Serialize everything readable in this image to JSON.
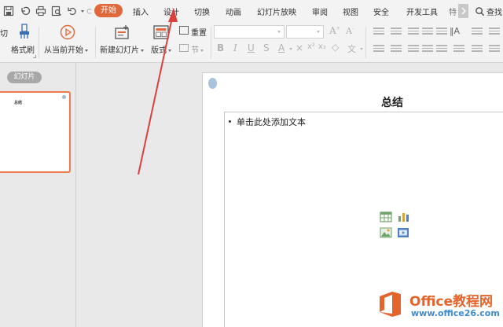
{
  "menu": {
    "tabs": [
      "插入",
      "设计",
      "切换",
      "动画",
      "幻灯片放映",
      "审阅",
      "视图",
      "安全",
      "开发工具"
    ],
    "active_tab": "开始",
    "overflow_tab": "特",
    "search_label": "查找"
  },
  "quick_access": [
    "save-icon",
    "undo-history-icon",
    "print-icon",
    "print-preview-icon",
    "undo-icon",
    "redo-icon"
  ],
  "ribbon": {
    "cut_label": "切",
    "format_painter_label": "格式刷",
    "play_from_current_label": "从当前开始",
    "new_slide_label": "新建幻灯片",
    "layout_label": "版式",
    "reset_label": "重置",
    "section_label": "节"
  },
  "panel": {
    "tab_label": "幻灯片",
    "thumbnail_title": "总结"
  },
  "slide": {
    "title": "总结",
    "content_placeholder": "单击此处添加文本"
  },
  "watermark": {
    "brand_office": "Office",
    "brand_cn": "教程网",
    "url": "www.office26.com"
  },
  "colors": {
    "accent": "#e0693c",
    "arrow": "#d9413d",
    "thumbnail_border": "#ef7a4d"
  }
}
